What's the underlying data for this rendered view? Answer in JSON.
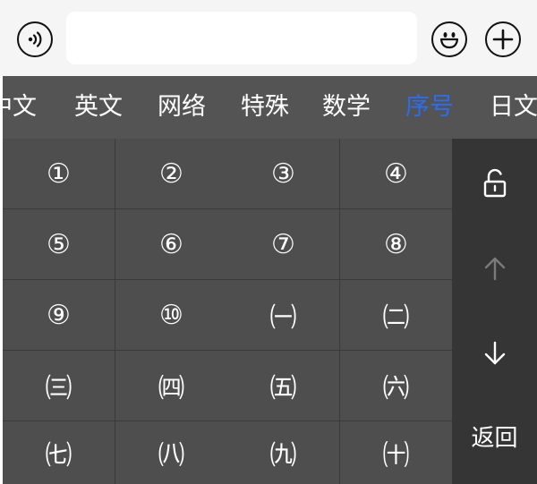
{
  "input_bar": {
    "text_value": "",
    "voice_icon": "voice-icon",
    "emoji_icon": "emoji-icon",
    "plus_icon": "plus-icon"
  },
  "categories": [
    {
      "label": "中文",
      "active": false
    },
    {
      "label": "英文",
      "active": false
    },
    {
      "label": "网络",
      "active": false
    },
    {
      "label": "特殊",
      "active": false
    },
    {
      "label": "数学",
      "active": false
    },
    {
      "label": "序号",
      "active": true
    },
    {
      "label": "日文",
      "active": false
    }
  ],
  "symbols": [
    [
      "①",
      "②",
      "③",
      "④"
    ],
    [
      "⑤",
      "⑥",
      "⑦",
      "⑧"
    ],
    [
      "⑨",
      "⑩",
      "㈠",
      "㈡"
    ],
    [
      "㈢",
      "㈣",
      "㈤",
      "㈥"
    ],
    [
      "㈦",
      "㈧",
      "㈨",
      "㈩"
    ]
  ],
  "side_panel": {
    "lock_icon": "unlock-icon",
    "up_icon": "arrow-up-icon",
    "down_icon": "arrow-down-icon",
    "back_label": "返回"
  },
  "colors": {
    "active_category": "#2b6df0",
    "key_bg": "#4e4e4e",
    "panel_bg": "#353535",
    "category_bg": "#545454"
  }
}
